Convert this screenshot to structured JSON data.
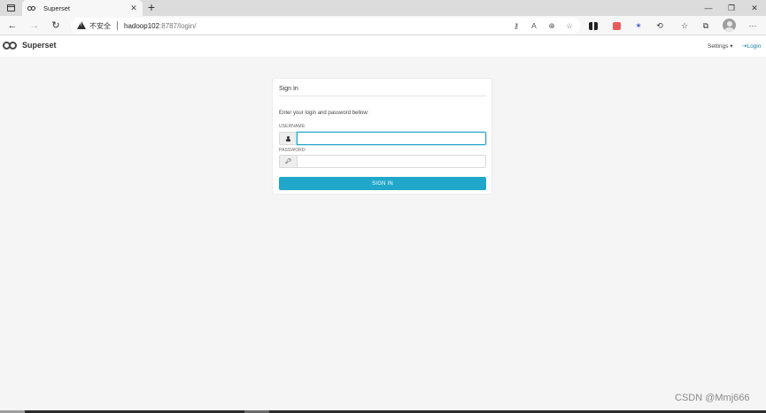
{
  "browser": {
    "tab_title": "Superset",
    "tab_close": "✕",
    "new_tab": "+",
    "window_controls": {
      "minimize": "—",
      "restore": "❐",
      "close": "✕"
    },
    "nav": {
      "back": "←",
      "forward": "→",
      "reload": "↻",
      "menu": "···"
    },
    "address": {
      "security_label": "不安全",
      "host": "hadoop102",
      "path": ":8787/login/"
    },
    "address_icons": [
      "key-icon",
      "read-aloud-icon",
      "zoom-icon",
      "favorite-add-icon"
    ],
    "toolbar_icons": [
      "extension-bars-icon",
      "extension-red-icon",
      "extension-star-icon",
      "extensions-icon",
      "favorites-icon",
      "collections-icon",
      "profile-icon"
    ]
  },
  "navbar": {
    "logo_text": "Superset",
    "settings_label": "Settings ▾",
    "login_label": "Login"
  },
  "login": {
    "title": "Sign In",
    "instruction": "Enter your login and password bellow:",
    "username_label": "USERNAME:",
    "username_value": "",
    "password_label": "PASSWORD:",
    "password_value": "",
    "submit_label": "SIGN IN"
  },
  "watermark": "CSDN @Mmj666",
  "colors": {
    "primary": "#20a7c9",
    "navbar_bg": "#ffffff",
    "page_bg": "#f5f5f5"
  }
}
